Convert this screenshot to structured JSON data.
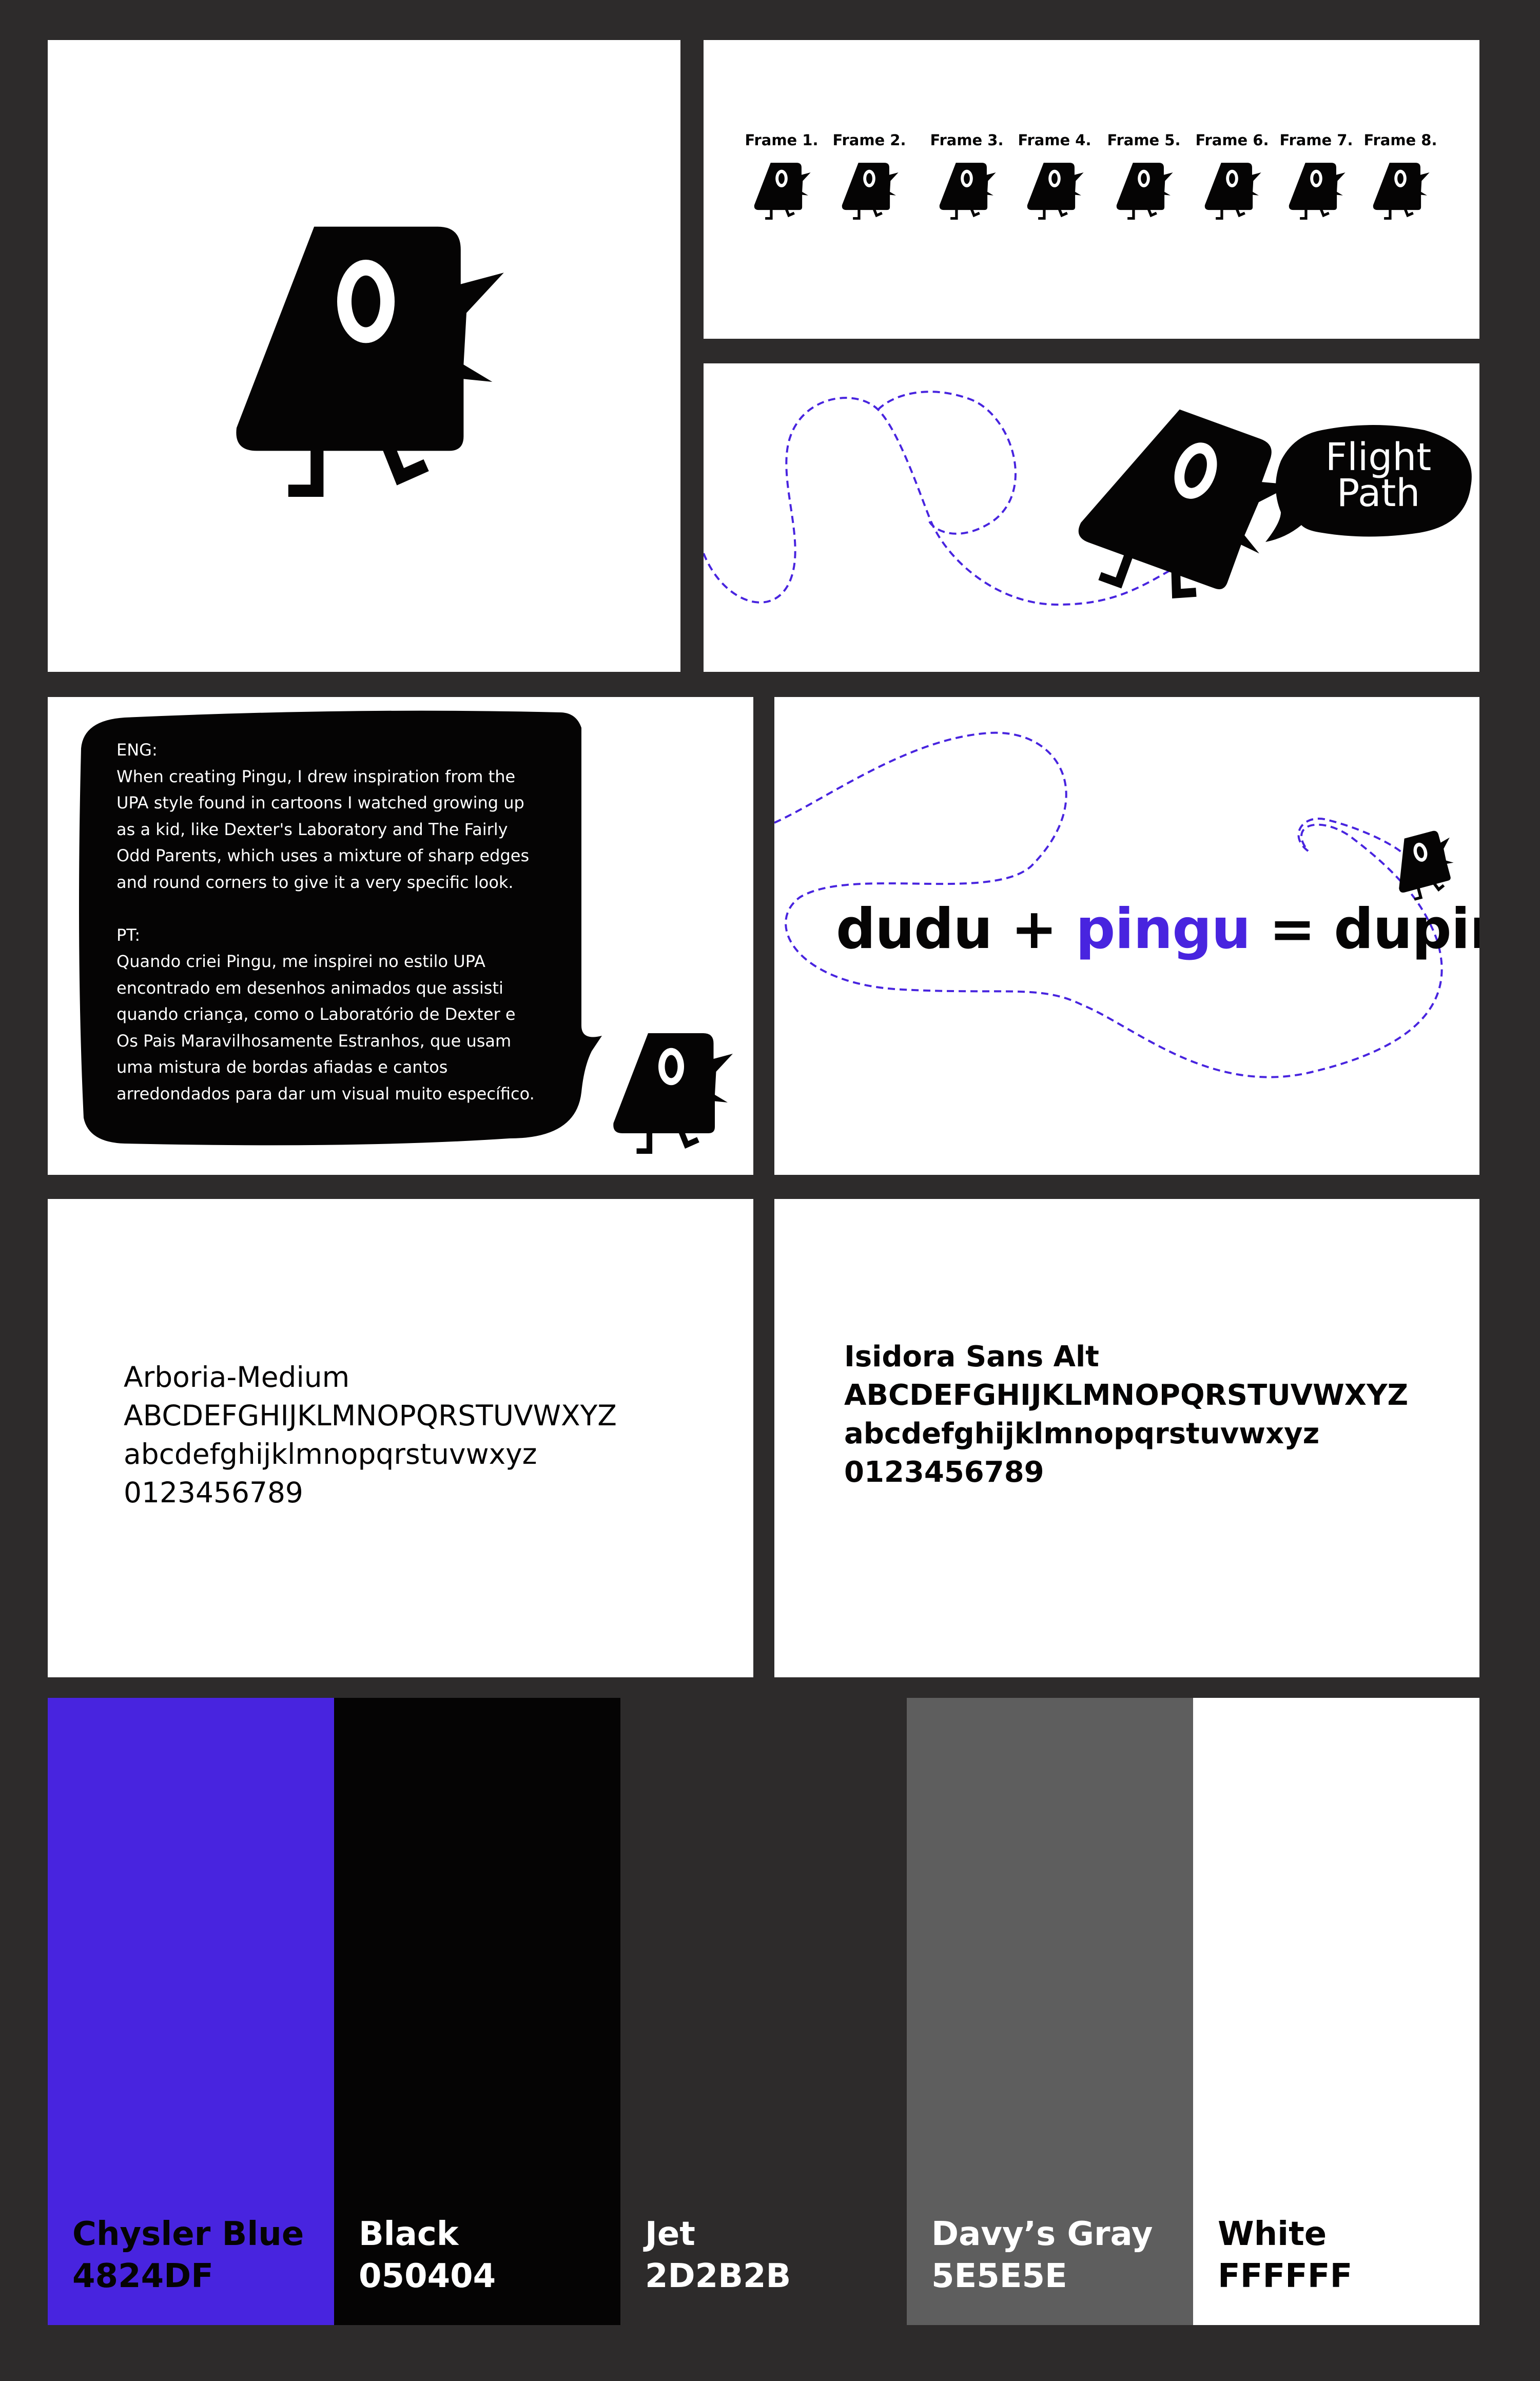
{
  "frames": {
    "labels": [
      "Frame 1.",
      "Frame 2.",
      "Frame 3.",
      "Frame 4.",
      "Frame 5.",
      "Frame 6.",
      "Frame 7.",
      "Frame 8."
    ]
  },
  "flight_path": {
    "line1": "Flight",
    "line2": "Path"
  },
  "story": {
    "eng_heading": "ENG:",
    "eng_lines": [
      "When creating Pingu, I drew inspiration from the",
      "UPA style found in cartoons I watched growing up",
      "as a kid, like Dexter's Laboratory and The Fairly",
      "Odd Parents, which uses a mixture of sharp edges",
      "and round corners to give it a very specific look."
    ],
    "pt_heading": "PT:",
    "pt_lines": [
      "Quando criei Pingu, me inspirei no estilo UPA",
      "encontrado em desenhos animados que assisti",
      "quando criança, como o Laboratório de Dexter e",
      "Os Pais Maravilhosamente Estranhos, que usam",
      "uma mistura de bordas afiadas e cantos",
      "arredondados para dar um visual muito específico."
    ]
  },
  "equation": {
    "part1": "dudu + ",
    "part2": "pingu",
    "part3": " = dupin"
  },
  "typefaces": {
    "primary": {
      "name": "Arboria-Medium",
      "upper": "ABCDEFGHIJKLMNOPQRSTUVWXYZ",
      "lower": "abcdefghijklmnopqrstuvwxyz",
      "digits": "0123456789"
    },
    "secondary": {
      "name": "Isidora Sans Alt",
      "upper": "ABCDEFGHIJKLMNOPQRSTUVWXYZ",
      "lower": "abcdefghijklmnopqrstuvwxyz",
      "digits": "0123456789"
    }
  },
  "palette": [
    {
      "name": "Chysler Blue",
      "hex_label": "4824DF",
      "color": "#4824DF",
      "text_color": "#050404"
    },
    {
      "name": "Black",
      "hex_label": "050404",
      "color": "#050404",
      "text_color": "#FFFFFF"
    },
    {
      "name": "Jet",
      "hex_label": "2D2B2B",
      "color": "#2D2B2B",
      "text_color": "#FFFFFF"
    },
    {
      "name": "Davy’s Gray",
      "hex_label": "5E5E5E",
      "color": "#5E5E5E",
      "text_color": "#FFFFFF"
    },
    {
      "name": "White",
      "hex_label": "FFFFFF",
      "color": "#FFFFFF",
      "text_color": "#050404"
    }
  ],
  "colors": {
    "background": "#2D2B2B",
    "accent": "#4824DF",
    "ink": "#050404",
    "panel": "#FFFFFF"
  },
  "icons": [
    "pingu-bird-icon",
    "flight-path-dashed-line",
    "speech-bubble-icon"
  ]
}
